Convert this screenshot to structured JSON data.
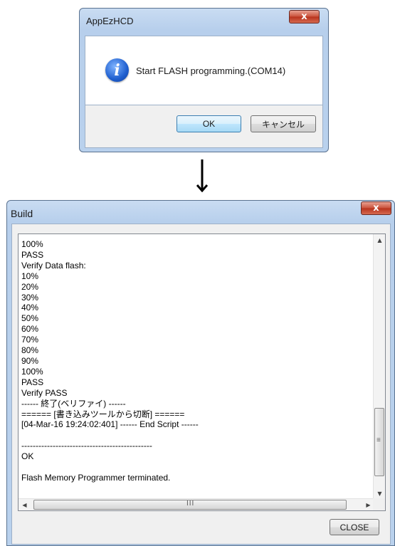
{
  "dialog1": {
    "title": "AppEzHCD",
    "close_glyph": "x",
    "icon": "info-icon",
    "message": "Start FLASH programming.(COM14)",
    "ok_label": "OK",
    "cancel_label": "キャンセル"
  },
  "arrow": {
    "icon": "arrow-down-icon"
  },
  "dialog2": {
    "title": "Build",
    "close_glyph": "x",
    "log_lines": [
      "100%",
      "PASS",
      "Verify Data flash:",
      "10%",
      "20%",
      "30%",
      "40%",
      "50%",
      "60%",
      "70%",
      "80%",
      "90%",
      "100%",
      "PASS",
      "Verify PASS",
      "------ 終了(ベリファイ) ------",
      "====== [書き込みツールから切断] ======",
      "[04-Mar-16 19:24:02:401] ------ End Script ------",
      "",
      "----------------------------------------------",
      "OK",
      "",
      "Flash Memory Programmer terminated."
    ],
    "close_label": "CLOSE",
    "scroll_up_glyph": "▲",
    "scroll_down_glyph": "▼",
    "scroll_left_glyph": "◀",
    "scroll_right_glyph": "▶",
    "vgrip": "≡",
    "hgrip": "III"
  }
}
